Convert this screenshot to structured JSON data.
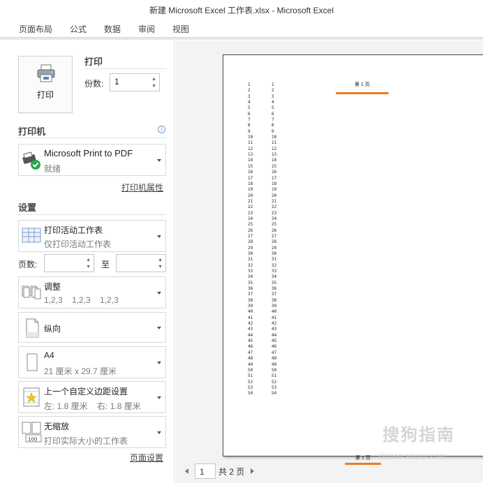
{
  "window": {
    "title": "新建 Microsoft Excel 工作表.xlsx - Microsoft Excel"
  },
  "menu": [
    "页面布局",
    "公式",
    "数据",
    "审阅",
    "视图"
  ],
  "print": {
    "button_label": "打印",
    "section_title": "打印",
    "copies_label": "份数:",
    "copies_value": "1"
  },
  "printer": {
    "section_title": "打印机",
    "name": "Microsoft Print to PDF",
    "status": "就绪",
    "properties_link": "打印机属性"
  },
  "settings": {
    "section_title": "设置",
    "scope": {
      "title": "打印活动工作表",
      "subtitle": "仅打印活动工作表"
    },
    "pages_label": "页数:",
    "pages_to_label": "至",
    "pages_from_value": "",
    "pages_to_value": "",
    "collate": {
      "title": "调整",
      "subtitle": "1,2,3    1,2,3    1,2,3"
    },
    "orientation": {
      "title": "纵向"
    },
    "paper": {
      "title": "A4",
      "subtitle": "21 厘米 x 29.7 厘米"
    },
    "margins": {
      "title": "上一个自定义边距设置",
      "subtitle": "左: 1.8 厘米    右: 1.8 厘米"
    },
    "scaling": {
      "title": "无缩放",
      "subtitle": "打印实际大小的工作表"
    },
    "page_setup_link": "页面设置"
  },
  "preview": {
    "header": "第 1 页",
    "footer": "第 1 页",
    "rows_start": 1,
    "rows_end": 54,
    "current_page": "1",
    "total_pages": "共 2 页"
  },
  "colors": {
    "accent_orange": "#f07a1e",
    "ok_green": "#2aa84a"
  },
  "watermark": {
    "text": "搜狗指南",
    "url": "zhinan.sogou.com"
  }
}
